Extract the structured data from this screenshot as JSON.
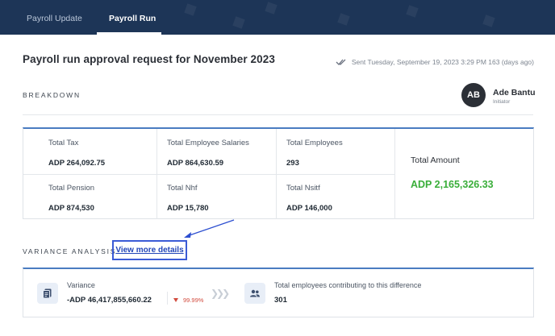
{
  "tabs": [
    {
      "label": "Payroll Update",
      "active": false
    },
    {
      "label": "Payroll Run",
      "active": true
    }
  ],
  "page": {
    "title": "Payroll run approval request for November 2023",
    "sent_text": "Sent Tuesday, September 19, 2023 3:29 PM 163 (days ago)"
  },
  "breakdown": {
    "label": "BREAKDOWN",
    "initiator": {
      "initials": "AB",
      "name": "Ade Bantu",
      "role": "Initiator"
    },
    "items": [
      {
        "label": "Total Tax",
        "value": "ADP 264,092.75"
      },
      {
        "label": "Total Employee Salaries",
        "value": "ADP 864,630.59"
      },
      {
        "label": "Total Employees",
        "value": "293"
      },
      {
        "label": "Total Pension",
        "value": "ADP 874,530"
      },
      {
        "label": "Total Nhf",
        "value": "ADP 15,780"
      },
      {
        "label": "Total Nsitf",
        "value": "ADP 146,000"
      }
    ],
    "total_amount_label": "Total Amount",
    "total_amount_value": "ADP 2,165,326.33"
  },
  "variance": {
    "label": "VARIANCE ANALYSIS",
    "view_more": "View more details",
    "variance_label": "Variance",
    "variance_value": "-ADP 46,417,855,660.22",
    "variance_pct": "99.99%",
    "employees_label": "Total employees contributing to this difference",
    "employees_value": "301"
  },
  "colors": {
    "header": "#1d3557",
    "accent": "#4a7cc1",
    "positive": "#3aae3a",
    "negative": "#d24b3e",
    "link": "#2246b8"
  }
}
